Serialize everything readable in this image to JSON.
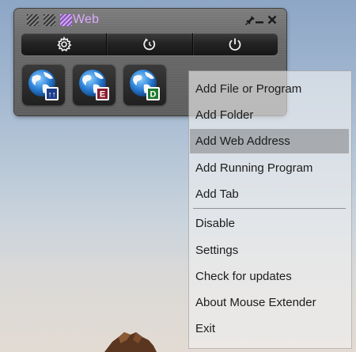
{
  "extender": {
    "active_tab_title": "Web",
    "tab_markers": [
      "tab-1",
      "tab-2",
      "tab-web"
    ],
    "title_buttons": [
      "pin-icon",
      "minimize-icon",
      "close-icon"
    ],
    "toolbar_icons": [
      "gear-icon",
      "refresh-icon",
      "power-icon"
    ],
    "tiles": [
      {
        "icon": "globe-icon",
        "badge": "↑↑",
        "badge_color": "#1a3c8a"
      },
      {
        "icon": "globe-icon",
        "badge": "E",
        "badge_color": "#8a1d2e"
      },
      {
        "icon": "globe-icon",
        "badge": "D",
        "badge_color": "#1f7a2e"
      }
    ]
  },
  "context_menu": {
    "groups": [
      [
        "Add File or Program",
        "Add Folder",
        "Add Web Address",
        "Add Running Program",
        "Add Tab"
      ],
      [
        "Disable",
        "Settings",
        "Check for updates",
        "About Mouse Extender",
        "Exit"
      ]
    ],
    "highlighted_item": "Add Web Address"
  },
  "colors": {
    "accent": "#dcaaff",
    "globe_blue": "#2a7fd6"
  }
}
